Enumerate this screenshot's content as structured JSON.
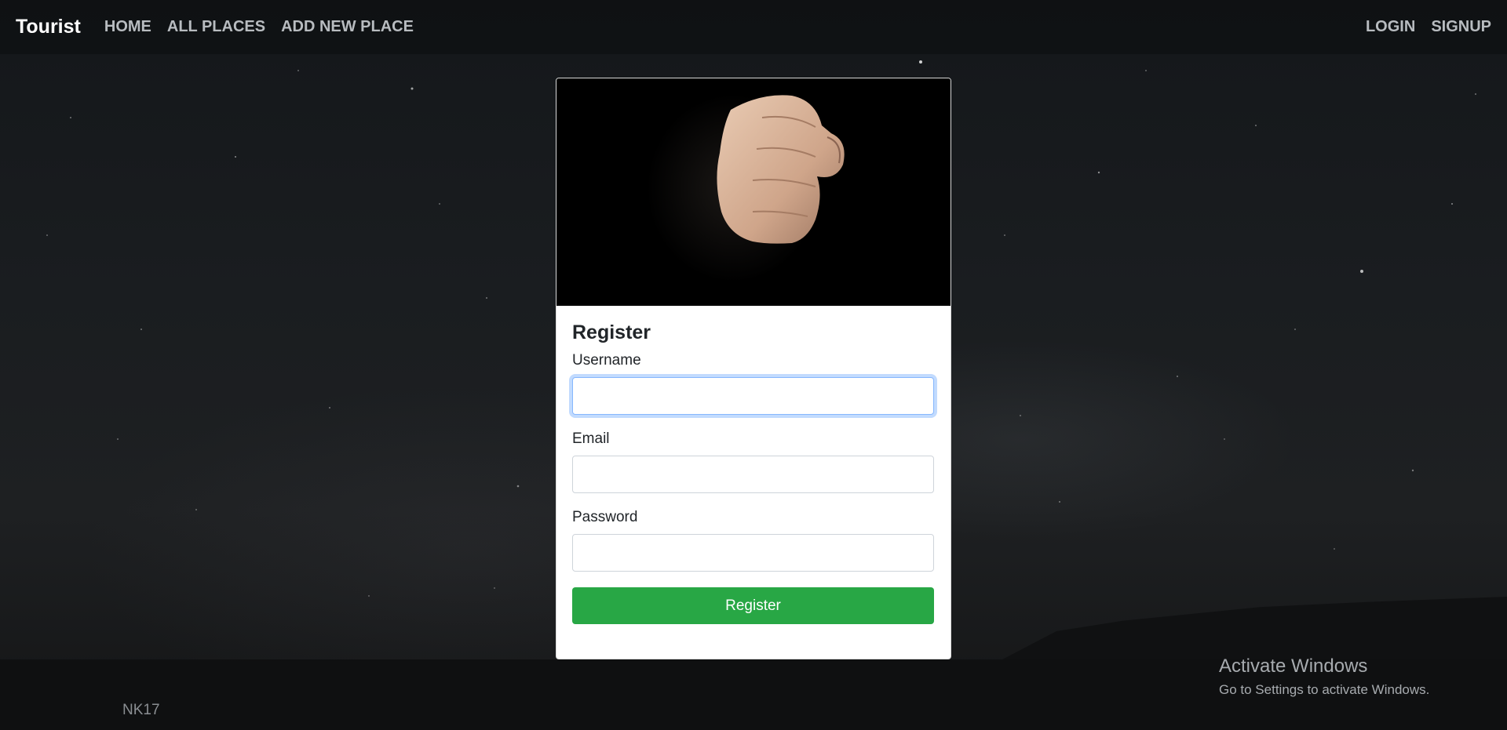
{
  "navbar": {
    "brand": "Tourist",
    "links": [
      "HOME",
      "ALL PLACES",
      "ADD NEW PLACE"
    ],
    "right_links": [
      "LOGIN",
      "SIGNUP"
    ]
  },
  "card": {
    "image_icon": "fist-photo",
    "title": "Register",
    "fields": {
      "username": {
        "label": "Username",
        "value": ""
      },
      "email": {
        "label": "Email",
        "value": ""
      },
      "password": {
        "label": "Password",
        "value": ""
      }
    },
    "submit_label": "Register"
  },
  "footer": {
    "text": "NK17"
  },
  "watermark": {
    "title": "Activate Windows",
    "subtitle": "Go to Settings to activate Windows."
  },
  "colors": {
    "accent": "#28a745",
    "focus": "#86b7fe"
  }
}
